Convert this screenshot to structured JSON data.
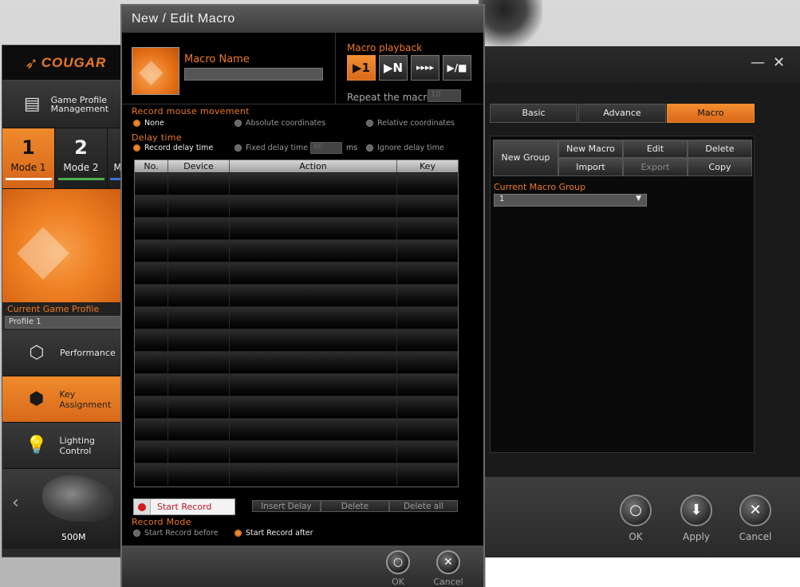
{
  "background": {},
  "main_app": {
    "logo": "COUGAR",
    "game_profile_label": "Game Profile Management",
    "modes": [
      {
        "label": "Mode 1",
        "icon": "1",
        "underline": "#ffffff",
        "active": true
      },
      {
        "label": "Mode 2",
        "icon": "2",
        "underline": "#4caf50",
        "active": false
      },
      {
        "label": "M",
        "icon": "",
        "underline": "#3b6fd6",
        "active": false
      }
    ],
    "current_profile_label": "Current Game Profile",
    "current_profile_value": "Profile 1",
    "nav_items": [
      {
        "label": "Performance",
        "icon": "performance-icon"
      },
      {
        "label": "Key Assignment",
        "icon": "key-assign-icon"
      },
      {
        "label": "Lighting Control",
        "icon": "lightbulb-icon"
      }
    ],
    "dpi": "500M",
    "prev_arrow": "‹"
  },
  "right_app": {
    "minimize": "—",
    "close": "✕",
    "tabs": [
      {
        "label": "Basic",
        "active": false
      },
      {
        "label": "Advance",
        "active": false
      },
      {
        "label": "Macro",
        "active": true
      }
    ],
    "buttons": {
      "new_group": "New Group",
      "new_macro": "New Macro",
      "edit": "Edit",
      "delete": "Delete",
      "import": "Import",
      "export": "Export",
      "copy": "Copy"
    },
    "current_group_label": "Current Macro Group",
    "current_group_value": "1",
    "footer": {
      "ok": "OK",
      "apply": "Apply",
      "cancel": "Cancel"
    }
  },
  "dialog": {
    "title": "New / Edit Macro",
    "macro_name_label": "Macro Name",
    "macro_name_value": "",
    "playback_label": "Macro playback",
    "playback_buttons": [
      {
        "name": "play-once",
        "glyph": "▶1",
        "active": true
      },
      {
        "name": "play-n-times",
        "glyph": "▶N",
        "active": false
      },
      {
        "name": "play-repeat",
        "glyph": "▸▸▸▸",
        "active": false
      },
      {
        "name": "play-stop",
        "glyph": "▶/■",
        "active": false
      }
    ],
    "repeat_label": "Repeat the macro",
    "repeat_value": "10",
    "record_mouse_label": "Record mouse movement",
    "mouse_options": [
      {
        "label": "None",
        "checked": true
      },
      {
        "label": "Absolute coordinates",
        "checked": false
      },
      {
        "label": "Relative coordinates",
        "checked": false
      }
    ],
    "delay_label": "Delay time",
    "delay_options": [
      {
        "label": "Record delay time",
        "checked": true
      },
      {
        "label": "Fixed delay time",
        "checked": false
      },
      {
        "label": "Ignore delay time",
        "checked": false
      }
    ],
    "fixed_delay_value": "40",
    "ms_label": "ms",
    "table": {
      "columns": [
        "No.",
        "Device",
        "Action",
        "Key"
      ],
      "rows": [
        [
          "",
          "",
          "",
          ""
        ],
        [
          "",
          "",
          "",
          ""
        ],
        [
          "",
          "",
          "",
          ""
        ],
        [
          "",
          "",
          "",
          ""
        ],
        [
          "",
          "",
          "",
          ""
        ],
        [
          "",
          "",
          "",
          ""
        ],
        [
          "",
          "",
          "",
          ""
        ],
        [
          "",
          "",
          "",
          ""
        ],
        [
          "",
          "",
          "",
          ""
        ],
        [
          "",
          "",
          "",
          ""
        ],
        [
          "",
          "",
          "",
          ""
        ],
        [
          "",
          "",
          "",
          ""
        ],
        [
          "",
          "",
          "",
          ""
        ],
        [
          "",
          "",
          "",
          ""
        ]
      ]
    },
    "start_record": "Start Record",
    "insert_delay": "Insert Delay",
    "delete": "Delete",
    "delete_all": "Delete all",
    "record_mode_label": "Record Mode",
    "record_mode_options": [
      {
        "label": "Start Record before",
        "checked": false
      },
      {
        "label": "Start Record after",
        "checked": true
      }
    ],
    "ok": "OK",
    "cancel": "Cancel"
  }
}
